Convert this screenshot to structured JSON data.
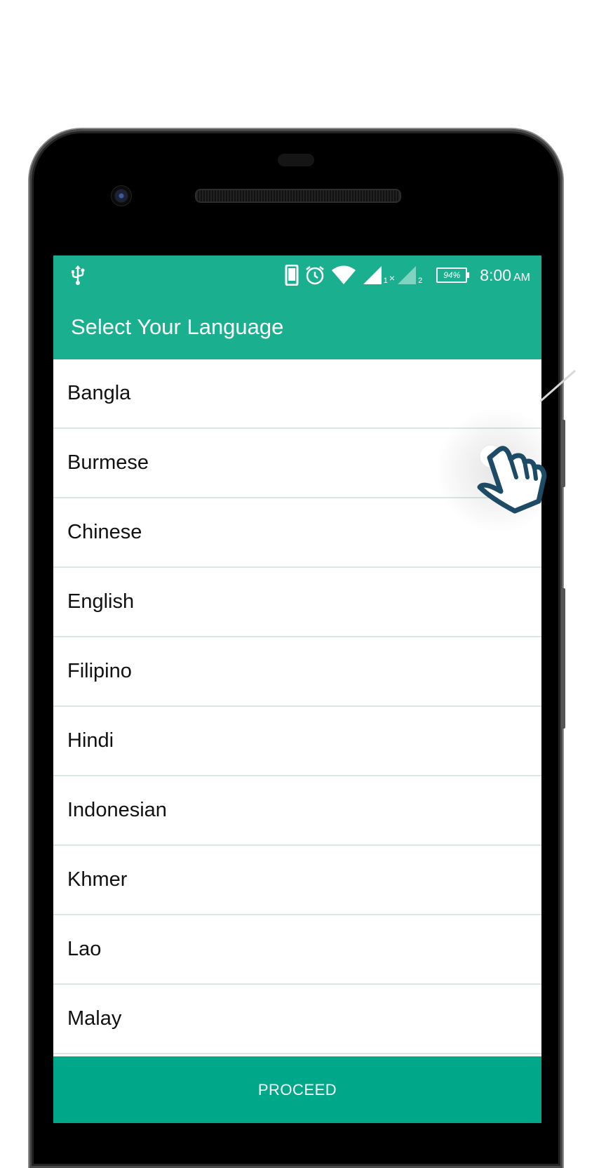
{
  "status_bar": {
    "usb_icon": "usb-icon",
    "icons": [
      "phone-icon",
      "alarm-icon",
      "wifi-icon",
      "signal-1-icon",
      "signal-2-icon"
    ],
    "sim1_label": "1",
    "sim2_label": "2",
    "battery": "94%",
    "time": "8:00",
    "ampm": "AM"
  },
  "app_bar": {
    "title": "Select Your Language"
  },
  "languages": [
    "Bangla",
    "Burmese",
    "Chinese",
    "English",
    "Filipino",
    "Hindi",
    "Indonesian",
    "Khmer",
    "Lao",
    "Malay"
  ],
  "proceed_label": "PROCEED",
  "colors": {
    "primary": "#1aaf8e",
    "button": "#00a88a",
    "divider": "#dbe6e6",
    "hand": "#1d4b66"
  }
}
